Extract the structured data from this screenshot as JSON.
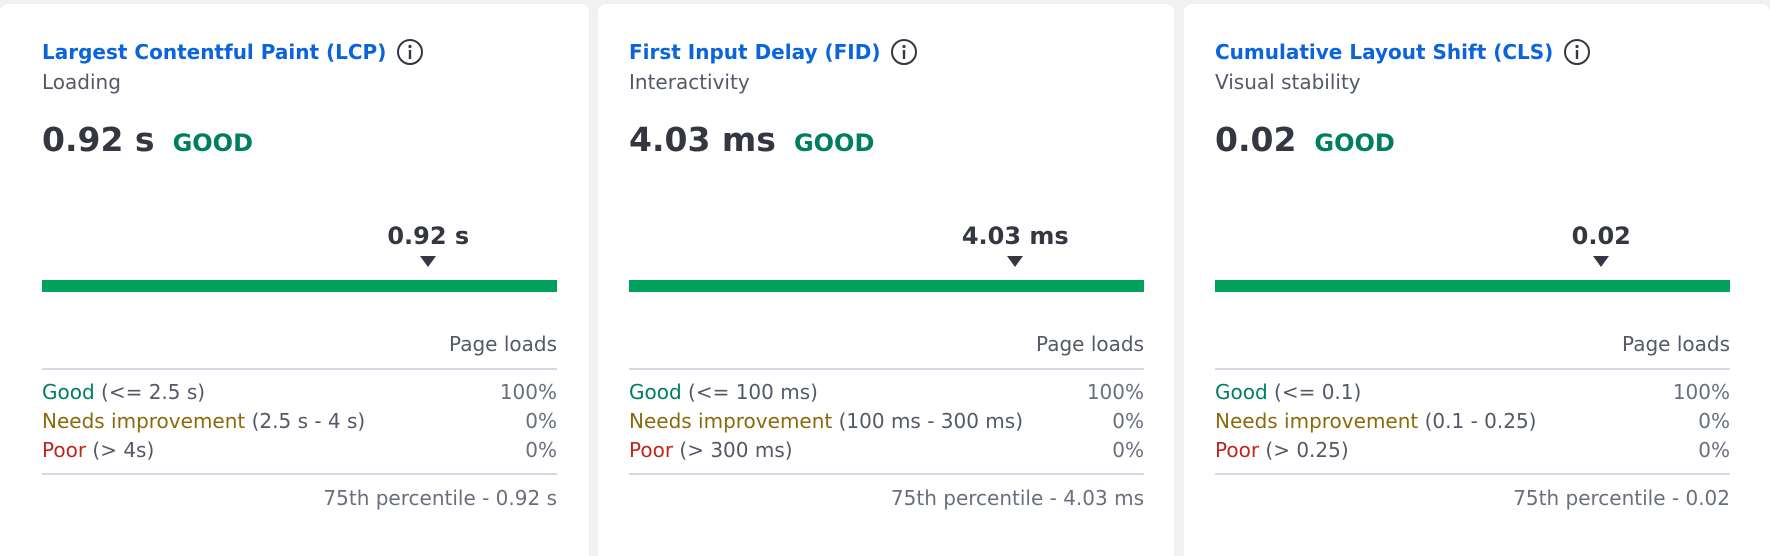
{
  "metrics": [
    {
      "title": "Largest Contentful Paint (LCP)",
      "subtitle": "Loading",
      "value": "0.92 s",
      "rating": "GOOD",
      "marker_value": "0.92 s",
      "marker_fraction": 0.75,
      "column_header": "Page loads",
      "distribution": {
        "good": {
          "label": "Good",
          "range": "(<= 2.5 s)",
          "percent": "100%"
        },
        "needs_improvement": {
          "label": "Needs improvement",
          "range": "(2.5 s - 4 s)",
          "percent": "0%"
        },
        "poor": {
          "label": "Poor",
          "range": "(> 4s)",
          "percent": "0%"
        }
      },
      "percentile": "75th percentile - 0.92 s"
    },
    {
      "title": "First Input Delay (FID)",
      "subtitle": "Interactivity",
      "value": "4.03 ms",
      "rating": "GOOD",
      "marker_value": "4.03 ms",
      "marker_fraction": 0.75,
      "column_header": "Page loads",
      "distribution": {
        "good": {
          "label": "Good",
          "range": "(<= 100 ms)",
          "percent": "100%"
        },
        "needs_improvement": {
          "label": "Needs improvement",
          "range": "(100 ms - 300 ms)",
          "percent": "0%"
        },
        "poor": {
          "label": "Poor",
          "range": "(> 300 ms)",
          "percent": "0%"
        }
      },
      "percentile": "75th percentile - 4.03 ms"
    },
    {
      "title": "Cumulative Layout Shift (CLS)",
      "subtitle": "Visual stability",
      "value": "0.02",
      "rating": "GOOD",
      "marker_value": "0.02",
      "marker_fraction": 0.75,
      "column_header": "Page loads",
      "distribution": {
        "good": {
          "label": "Good",
          "range": "(<= 0.1)",
          "percent": "100%"
        },
        "needs_improvement": {
          "label": "Needs improvement",
          "range": "(0.1 - 0.25)",
          "percent": "0%"
        },
        "poor": {
          "label": "Poor",
          "range": "(> 0.25)",
          "percent": "0%"
        }
      },
      "percentile": "75th percentile - 0.02"
    }
  ],
  "icons": {
    "info": "info-icon"
  },
  "colors": {
    "title_link": "#0b64dd",
    "good": "#007e60",
    "needs_improvement": "#8a6a0a",
    "poor": "#bd271e",
    "good_bar": "#00a15d"
  }
}
